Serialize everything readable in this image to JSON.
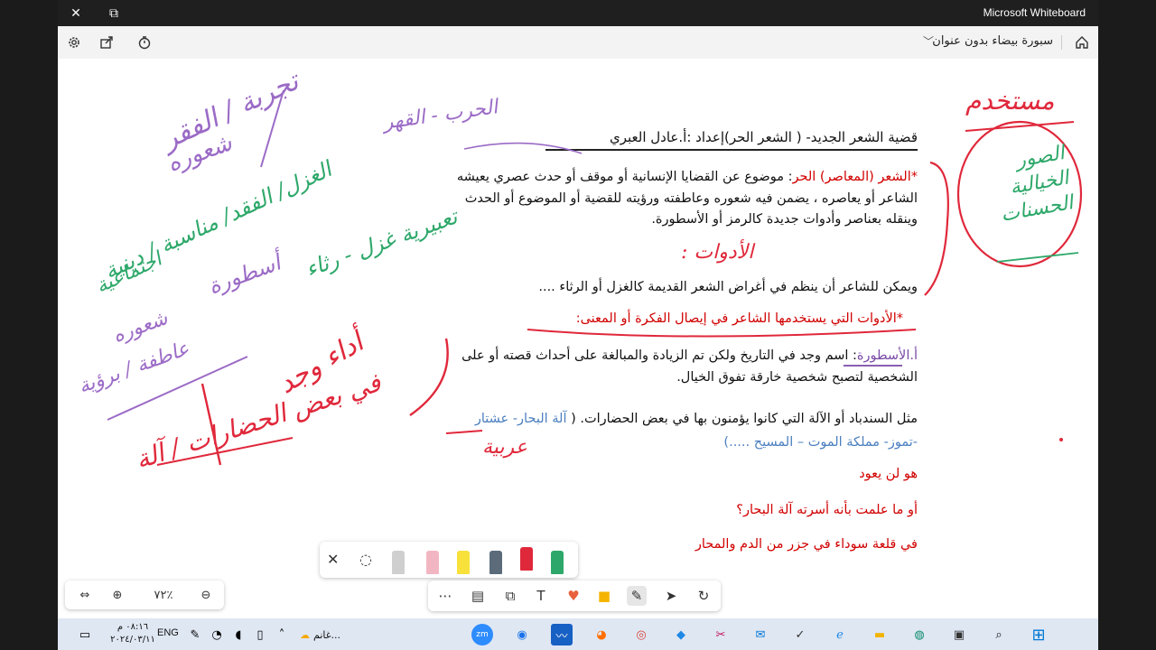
{
  "titlebar": {
    "app_title": "Microsoft Whiteboard",
    "close": "✕",
    "restore": "⧉"
  },
  "toolbar": {
    "board_name": "سبورة بيضاء بدون عنوان",
    "chevron": "﹀"
  },
  "document": {
    "title": "قضية الشعر الجديد- ( الشعر الحر)إعداد :أ.عادل العبري",
    "para_lead": "*الشعر (المعاصر) الحر",
    "para_lead_purple": "",
    "para_body": ": موضوع عن القضايا الإنسانية أو موقف أو حدث عصري يعيشه الشاعر أو يعاصره ، يضمن فيه شعوره وعاطفته ورؤيته للقضية أو الموضوع أو الحدث وينقله بعناصر وأدوات جديدة كالرمز أو الأسطورة.",
    "line2": "ويمكن للشاعر أن ينظم في أغراض الشعر القديمة كالغزل أو الرثاء ....",
    "tools_title": "*الأدوات التي يستخدمها الشاعر في إيصال الفكرة أو المعنى:",
    "ostora_label": "أ.الأسطورة",
    "ostora_body": ": اسم وجد في التاريخ ولكن تم الزيادة والمبالغة على أحداث قصته أو على الشخصية لتصبح شخصية خارقة تفوق الخيال.",
    "example_text": "مثل السندباد أو الآلة التي كانوا يؤمنون بها في بعض الحضارات. (",
    "example_blue": "آلة البحار- عشتار -تموز- مملكة الموت – المسيح .....)",
    "poem": [
      "هو لن يعود",
      "أو ما علمت بأنه أسرته آلة البحار؟",
      "في قلعة سوداء في جزر من الدم والمحار"
    ]
  },
  "handwriting": {
    "purple_1": "تجربة / الفقر",
    "purple_2": "شعوره",
    "purple_3": "الحرب - القهر",
    "green_1": "الغزل/ الفقد/ مناسبة / دينية",
    "green_2": "اجتماعية",
    "green_3": "تعبيرية غزل - رثاء",
    "purple_4": "أسطورة",
    "purple_5": "شعوره",
    "purple_6": "عاطفة / برؤية",
    "red_1": "أداء وجد",
    "red_2": "في بعض الحضارات / آلة",
    "red_3": "عربية",
    "red_4": "الأدوات :",
    "red_right": "مستخدم",
    "green_right": "الصور الخيالية الحسنات"
  },
  "zoom": {
    "level": "٧٢٪"
  },
  "taskbar": {
    "time": "٠٨:١٦ م",
    "date": "٢٠٢٤/٠٣/١١",
    "lang": "ENG",
    "ghanem": "غانم..."
  },
  "colors": {
    "accent_red": "#e0283b",
    "accent_purple": "#9b6bc6",
    "accent_green": "#2ea86a",
    "blue_text": "#4b7fc0"
  }
}
